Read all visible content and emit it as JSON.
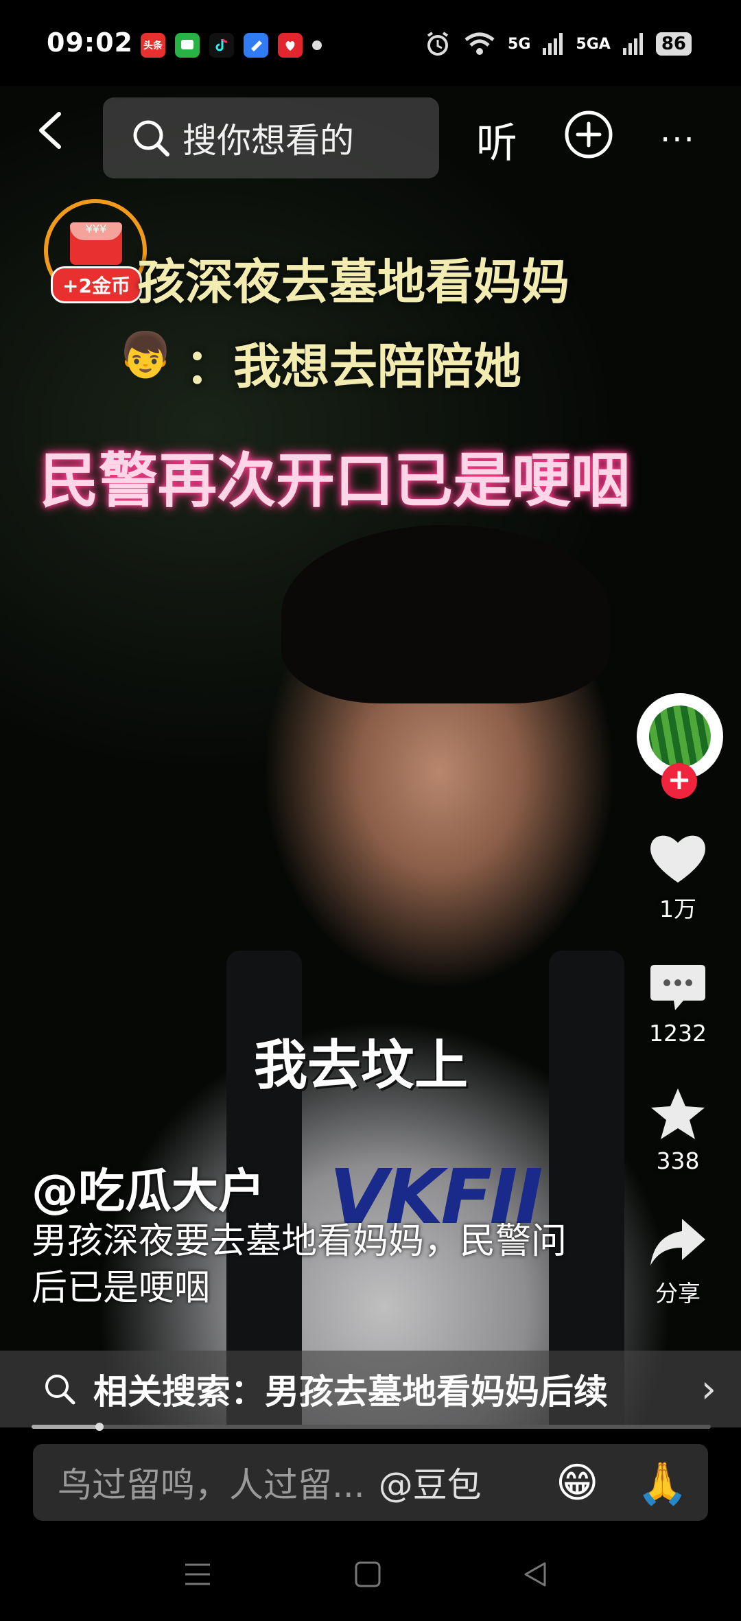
{
  "status": {
    "time": "09:02",
    "apps": [
      {
        "name": "toutiao-icon",
        "label": "头条",
        "color": "#e8302f"
      },
      {
        "name": "messages-icon",
        "label": "",
        "color": "#27b345"
      },
      {
        "name": "douyin-icon",
        "label": "",
        "color": "#111111"
      },
      {
        "name": "blue-app-icon",
        "label": "",
        "color": "#2f7cf6"
      },
      {
        "name": "red-app-icon",
        "label": "",
        "color": "#e3262d"
      }
    ],
    "network": "5G",
    "network2": "5GA",
    "battery": "86"
  },
  "nav": {
    "search_placeholder": "搜你想看的",
    "listen_label": "听",
    "more_label": "···"
  },
  "reward": {
    "badge": "+2金币"
  },
  "video": {
    "caption_line1": "孩深夜去墓地看妈妈",
    "caption_line2": "：我想去陪陪她",
    "caption_line3": "民警再次开口已是哽咽",
    "subtitle": "我去坟上",
    "shirt_text": "VKFII"
  },
  "actions": {
    "likes": "1万",
    "comments": "1232",
    "favorites": "338",
    "share": "分享"
  },
  "post": {
    "author": "@吃瓜大户",
    "description": "男孩深夜要去墓地看妈妈，民警问后已是哽咽"
  },
  "related": {
    "text": "相关搜索：男孩去墓地看妈妈后续"
  },
  "playback": {
    "progress": 0.1
  },
  "comment": {
    "placeholder": "鸟过留鸣，人过留...",
    "mention": "@豆包"
  },
  "colors": {
    "accent": "#f0243d",
    "reward_ring": "#f29a1a"
  }
}
